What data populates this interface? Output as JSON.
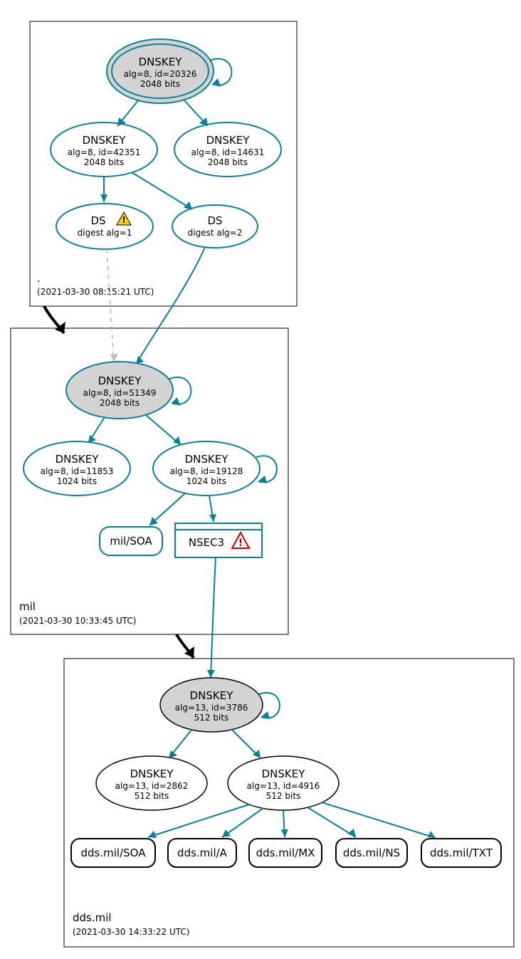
{
  "zones": {
    "root": {
      "label": ".",
      "timestamp": "(2021-03-30 08:15:21 UTC)"
    },
    "mil": {
      "label": "mil",
      "timestamp": "(2021-03-30 10:33:45 UTC)"
    },
    "dds": {
      "label": "dds.mil",
      "timestamp": "(2021-03-30 14:33:22 UTC)"
    }
  },
  "nodes": {
    "root_ksk": {
      "title": "DNSKEY",
      "sub1": "alg=8, id=20326",
      "sub2": "2048 bits"
    },
    "root_zsk1": {
      "title": "DNSKEY",
      "sub1": "alg=8, id=42351",
      "sub2": "2048 bits"
    },
    "root_zsk2": {
      "title": "DNSKEY",
      "sub1": "alg=8, id=14631",
      "sub2": "2048 bits"
    },
    "ds1": {
      "title": "DS",
      "sub1": "digest alg=1"
    },
    "ds2": {
      "title": "DS",
      "sub1": "digest alg=2"
    },
    "mil_ksk": {
      "title": "DNSKEY",
      "sub1": "alg=8, id=51349",
      "sub2": "2048 bits"
    },
    "mil_zsk1": {
      "title": "DNSKEY",
      "sub1": "alg=8, id=11853",
      "sub2": "1024 bits"
    },
    "mil_zsk2": {
      "title": "DNSKEY",
      "sub1": "alg=8, id=19128",
      "sub2": "1024 bits"
    },
    "mil_soa": {
      "label": "mil/SOA"
    },
    "nsec3": {
      "label": "NSEC3"
    },
    "dds_ksk": {
      "title": "DNSKEY",
      "sub1": "alg=13, id=3786",
      "sub2": "512 bits"
    },
    "dds_zsk1": {
      "title": "DNSKEY",
      "sub1": "alg=13, id=2862",
      "sub2": "512 bits"
    },
    "dds_zsk2": {
      "title": "DNSKEY",
      "sub1": "alg=13, id=4916",
      "sub2": "512 bits"
    },
    "rr_soa": {
      "label": "dds.mil/SOA"
    },
    "rr_a": {
      "label": "dds.mil/A"
    },
    "rr_mx": {
      "label": "dds.mil/MX"
    },
    "rr_ns": {
      "label": "dds.mil/NS"
    },
    "rr_txt": {
      "label": "dds.mil/TXT"
    }
  },
  "colors": {
    "teal": "#0a7f96",
    "grey_fill": "#d3d3d3"
  }
}
